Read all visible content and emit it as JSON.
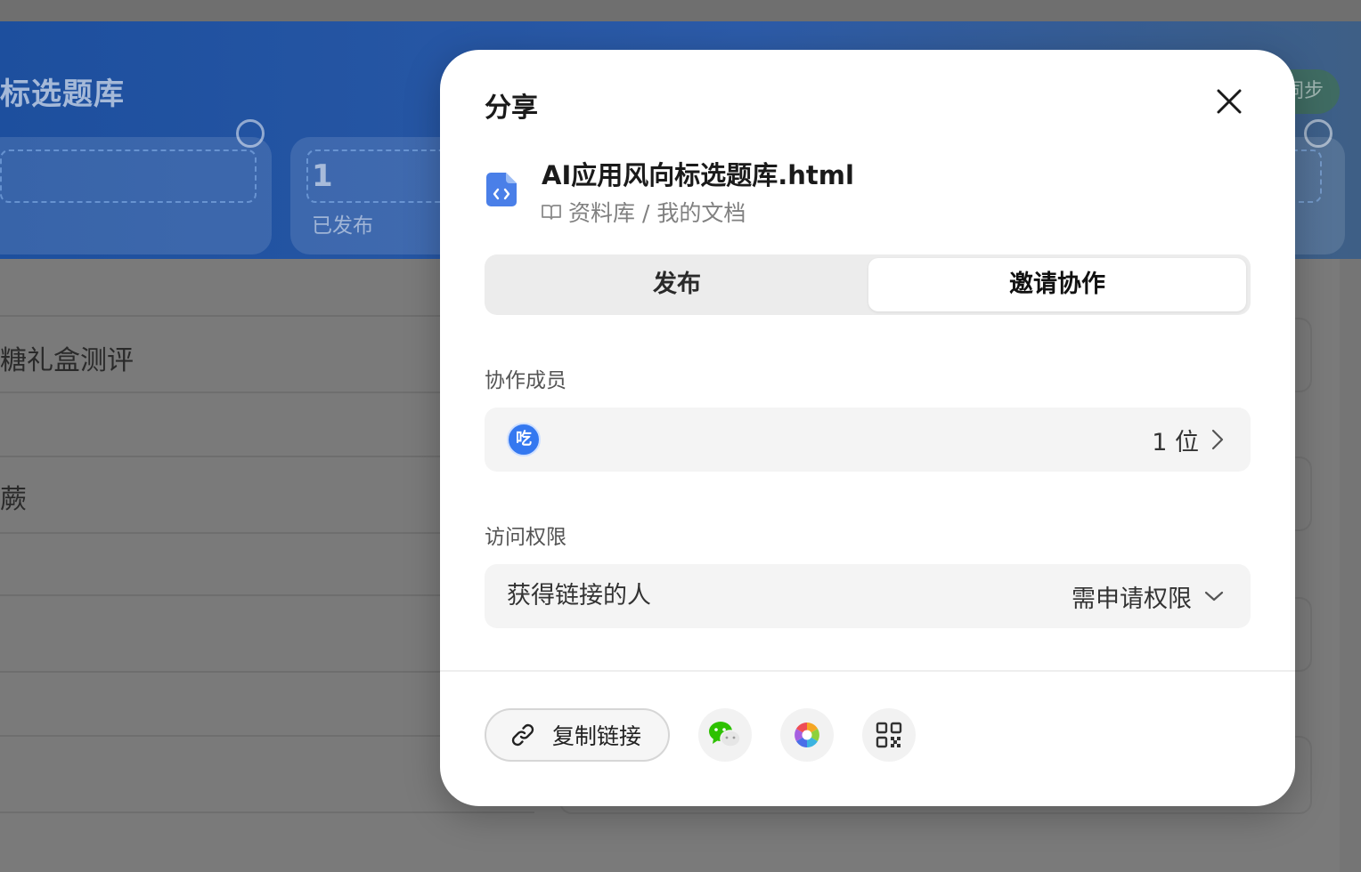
{
  "background": {
    "title": "标选题库",
    "stat_value": "1",
    "stat_label": "已发布",
    "sync_label": "同步",
    "rows": [
      "糖礼盒测评",
      "蕨"
    ]
  },
  "modal": {
    "title": "分享",
    "file": {
      "name": "AI应用风向标选题库.html",
      "path": "资料库 / 我的文档"
    },
    "tabs": [
      {
        "label": "发布",
        "active": false
      },
      {
        "label": "邀请协作",
        "active": true
      }
    ],
    "members": {
      "label": "协作成员",
      "avatar_text": "吃",
      "count_text": "1 位"
    },
    "access": {
      "label": "访问权限",
      "scope": "获得链接的人",
      "permission": "需申请权限"
    },
    "actions": {
      "copy_link": "复制链接"
    },
    "icons": [
      "close-icon",
      "html-file-icon",
      "book-icon",
      "chevron-right-icon",
      "chevron-down-icon",
      "link-icon",
      "wechat-icon",
      "moments-icon",
      "qr-code-icon"
    ],
    "colors": {
      "accent": "#3478f0",
      "wechat": "#2dc100"
    }
  }
}
